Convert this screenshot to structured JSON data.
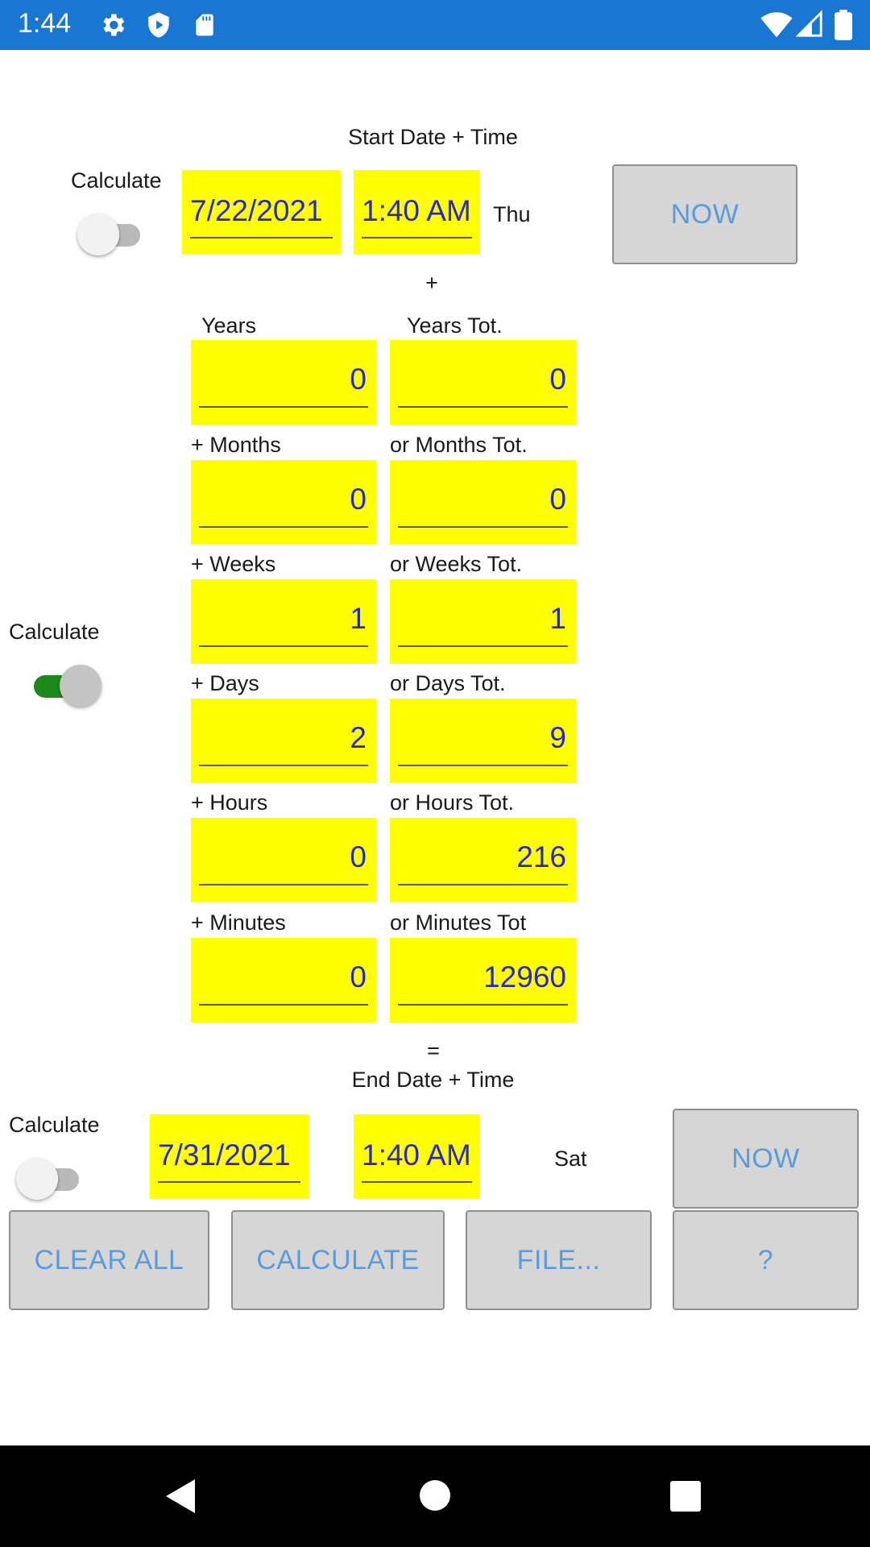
{
  "status_bar": {
    "time": "1:44",
    "left_icons": [
      "gear-icon",
      "shield-play-icon",
      "sd-card-icon"
    ],
    "right_icons": [
      "wifi-icon",
      "signal-icon",
      "battery-icon"
    ]
  },
  "start": {
    "heading": "Start Date + Time",
    "calculate_label": "Calculate",
    "calculate_on": false,
    "date": "7/22/2021",
    "time": "1:40 AM",
    "weekday": "Thu",
    "now_label": "NOW"
  },
  "plus_sign": "+",
  "duration": {
    "calculate_label": "Calculate",
    "calculate_on": true,
    "rows": [
      {
        "label": "Years",
        "value": "0",
        "total_label": "Years Tot.",
        "total": "0"
      },
      {
        "label": "+ Months",
        "value": "0",
        "total_label": "or Months Tot.",
        "total": "0"
      },
      {
        "label": "+ Weeks",
        "value": "1",
        "total_label": "or Weeks Tot.",
        "total": "1"
      },
      {
        "label": "+ Days",
        "value": "2",
        "total_label": "or Days Tot.",
        "total": "9"
      },
      {
        "label": "+ Hours",
        "value": "0",
        "total_label": "or Hours Tot.",
        "total": "216"
      },
      {
        "label": "+ Minutes",
        "value": "0",
        "total_label": "or Minutes Tot",
        "total": "12960"
      }
    ]
  },
  "equals_sign": "=",
  "end": {
    "heading": "End Date + Time",
    "calculate_label": "Calculate",
    "calculate_on": false,
    "date": "7/31/2021",
    "time": "1:40 AM",
    "weekday": "Sat",
    "now_label": "NOW"
  },
  "actions": {
    "clear_all": "CLEAR ALL",
    "calculate": "CALCULATE",
    "file": "FILE...",
    "help": "?"
  },
  "colors": {
    "status_bar": "#1976d2",
    "field_bg": "#ffff00",
    "field_text": "#2929b8",
    "button_text": "#5b9bdc",
    "toggle_on": "#1b8a1b"
  }
}
